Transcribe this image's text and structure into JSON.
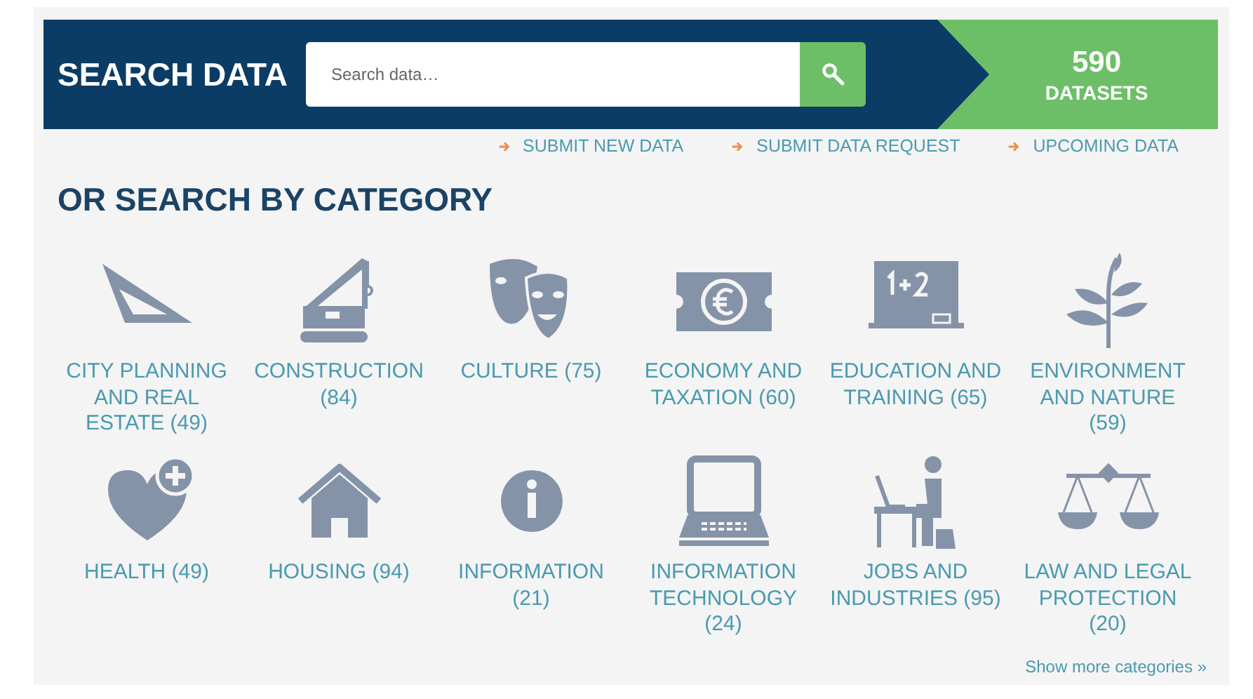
{
  "header": {
    "title": "SEARCH DATA",
    "search": {
      "placeholder": "Search data…"
    },
    "count": {
      "value": "590",
      "label": "DATASETS"
    }
  },
  "links": [
    "SUBMIT NEW DATA",
    "SUBMIT DATA REQUEST",
    "UPCOMING DATA"
  ],
  "heading": "OR SEARCH BY CATEGORY",
  "categories": [
    {
      "label": "CITY PLANNING AND REAL ESTATE (49)"
    },
    {
      "label": "CONSTRUCTION (84)"
    },
    {
      "label": "CULTURE (75)"
    },
    {
      "label": "ECONOMY AND TAXATION (60)"
    },
    {
      "label": "EDUCATION AND TRAINING (65)"
    },
    {
      "label": "ENVIRONMENT AND NATURE (59)"
    },
    {
      "label": "HEALTH (49)"
    },
    {
      "label": "HOUSING (94)"
    },
    {
      "label": "INFORMATION (21)"
    },
    {
      "label": "INFORMATION TECHNOLOGY (24)"
    },
    {
      "label": "JOBS AND INDUSTRIES (95)"
    },
    {
      "label": "LAW AND LEGAL PROTECTION (20)"
    }
  ],
  "more_link": "Show more categories »"
}
